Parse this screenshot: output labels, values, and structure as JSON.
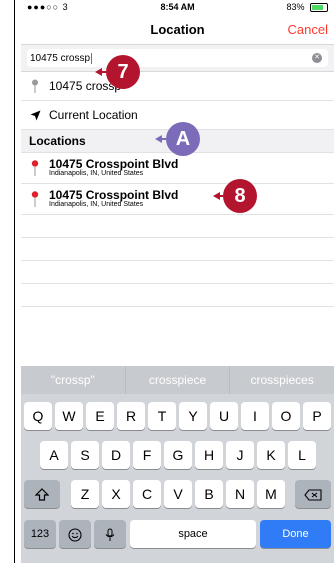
{
  "status": {
    "signal": "●●●○○ 3",
    "time": "8:54 AM",
    "battery": "83%"
  },
  "nav": {
    "title": "Location",
    "cancel": "Cancel"
  },
  "search": {
    "value": "10475 crossp"
  },
  "results": {
    "query_row": "10475 crossp",
    "current_location": "Current Location",
    "section": "Locations",
    "locations": [
      {
        "name": "10475 Crosspoint Blvd",
        "address": "Indianapolis, IN, United States"
      },
      {
        "name": "10475 Crosspoint Blvd",
        "address": "Indianapolis, IN, United States"
      }
    ]
  },
  "keyboard": {
    "suggestions": [
      "\"crossp\"",
      "crosspiece",
      "crosspieces"
    ],
    "row1": [
      "Q",
      "W",
      "E",
      "R",
      "T",
      "Y",
      "U",
      "I",
      "O",
      "P"
    ],
    "row2": [
      "A",
      "S",
      "D",
      "F",
      "G",
      "H",
      "J",
      "K",
      "L"
    ],
    "row3": [
      "Z",
      "X",
      "C",
      "V",
      "B",
      "N",
      "M"
    ],
    "numbers": "123",
    "space": "space",
    "done": "Done"
  },
  "callouts": {
    "seven": "7",
    "a": "A",
    "eight": "8"
  },
  "colors": {
    "accent": "#ff3b30",
    "pin": "#e0202a",
    "done": "#2f7cf6",
    "callout": "#b3142e",
    "callout_alt": "#7b6bb8"
  }
}
